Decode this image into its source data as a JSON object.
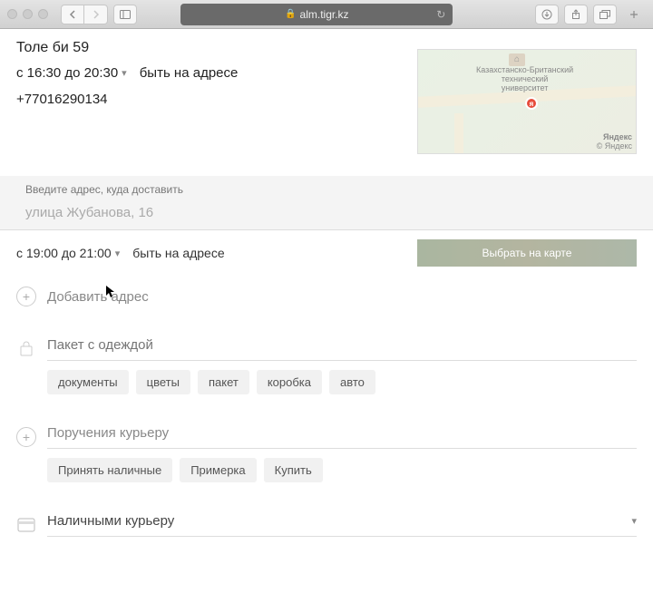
{
  "browser": {
    "url": "alm.tigr.kz"
  },
  "address1": {
    "text": "Толе би 59",
    "time": "с 16:30 до 20:30",
    "hint": "быть на адресе",
    "phone": "+77016290134"
  },
  "map": {
    "poi": "Казахстанско-Британский\nтехнический\nуниверситет",
    "attrib1": "Яндекс",
    "attrib2": "© Яндекс"
  },
  "address2": {
    "label": "Введите адрес, куда доставить",
    "placeholder": "улица Жубанова, 16",
    "time": "с 19:00 до 21:00",
    "hint": "быть на адресе",
    "map_button": "Выбрать на карте"
  },
  "add_address": "Добавить адрес",
  "package": {
    "placeholder": "Пакет с одеждой",
    "tags": [
      "документы",
      "цветы",
      "пакет",
      "коробка",
      "авто"
    ]
  },
  "tasks": {
    "placeholder": "Поручения курьеру",
    "tags": [
      "Принять наличные",
      "Примерка",
      "Купить"
    ]
  },
  "payment": {
    "label": "Наличными курьеру"
  }
}
